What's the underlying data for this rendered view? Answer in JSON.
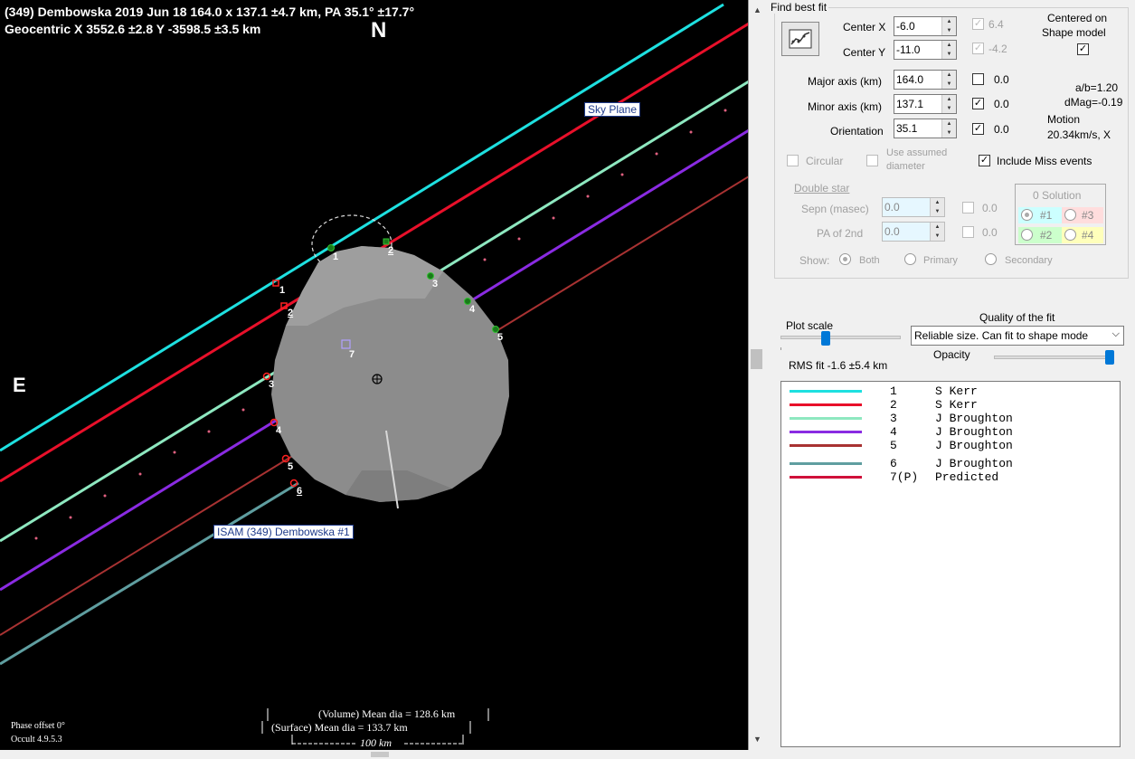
{
  "plot": {
    "header_line1": "(349) Dembowska  2019 Jun 18  164.0 x 137.1 ±4.7 km, PA 35.1° ±17.7°",
    "header_line2": "Geocentric  X  3552.6 ±2.8  Y -3598.5 ±3.5 km",
    "north": "N",
    "east": "E",
    "sky_plane": "Sky Plane",
    "isam_label": "ISAM (349) Dembowska  #1",
    "volume_dia": "(Volume) Mean dia = 128.6 km",
    "surface_dia": "(Surface) Mean dia = 133.7 km",
    "scale_bar": "100 km",
    "phase_offset": "Phase offset 0°",
    "version": "Occult 4.9.5.3",
    "chord_numbers_left": [
      "1",
      "2",
      "3",
      "4",
      "5",
      "6"
    ],
    "chord_numbers_right": [
      "1",
      "2",
      "3",
      "4",
      "5"
    ],
    "predicted_label": "7"
  },
  "panel": {
    "find_best_fit": "Find best fit",
    "center_x_label": "Center X",
    "center_x": "-6.0",
    "center_x_chk": "6.4",
    "center_y_label": "Center Y",
    "center_y": "-11.0",
    "center_y_chk": "-4.2",
    "centered_on": "Centered on",
    "shape_model": "Shape model",
    "major_label": "Major axis (km)",
    "major": "164.0",
    "major_chk": "0.0",
    "minor_label": "Minor axis (km)",
    "minor": "137.1",
    "minor_chk": "0.0",
    "orient_label": "Orientation",
    "orient": "35.1",
    "orient_chk": "0.0",
    "ab_ratio": "a/b=1.20",
    "dmag": "dMag=-0.19",
    "motion": "Motion",
    "motion_val": "20.34km/s, X",
    "circular": "Circular",
    "use_assumed": "Use assumed",
    "diameter": "diameter",
    "include_miss": "Include Miss events",
    "double_star": "Double star",
    "sepn_label": "Sepn (masec)",
    "sepn": "0.0",
    "sepn_chk": "0.0",
    "pa2_label": "PA of 2nd",
    "pa2": "0.0",
    "pa2_chk": "0.0",
    "solution": "0 Solution",
    "sol1": "#1",
    "sol2": "#2",
    "sol3": "#3",
    "sol4": "#4",
    "show_label": "Show:",
    "show_both": "Both",
    "show_primary": "Primary",
    "show_secondary": "Secondary",
    "plot_scale": "Plot scale",
    "quality_label": "Quality of the fit",
    "quality_value": "Reliable size. Can fit to shape mode",
    "opacity": "Opacity",
    "rms_fit": "RMS fit -1.6 ±5.4 km"
  },
  "legend": [
    {
      "num": "1",
      "observer": "S Kerr",
      "color": "#1ee0e0"
    },
    {
      "num": "2",
      "observer": "S Kerr",
      "color": "#e8102a"
    },
    {
      "num": "3",
      "observer": "J Broughton",
      "color": "#8ee8c0"
    },
    {
      "num": "4",
      "observer": "J Broughton",
      "color": "#8a2be2"
    },
    {
      "num": "5",
      "observer": "J Broughton",
      "color": "#a83232"
    },
    {
      "num": "6",
      "observer": "J Broughton",
      "color": "#5f9ea0"
    },
    {
      "num": "7(P)",
      "observer": "Predicted",
      "color": "#d0103a"
    }
  ]
}
